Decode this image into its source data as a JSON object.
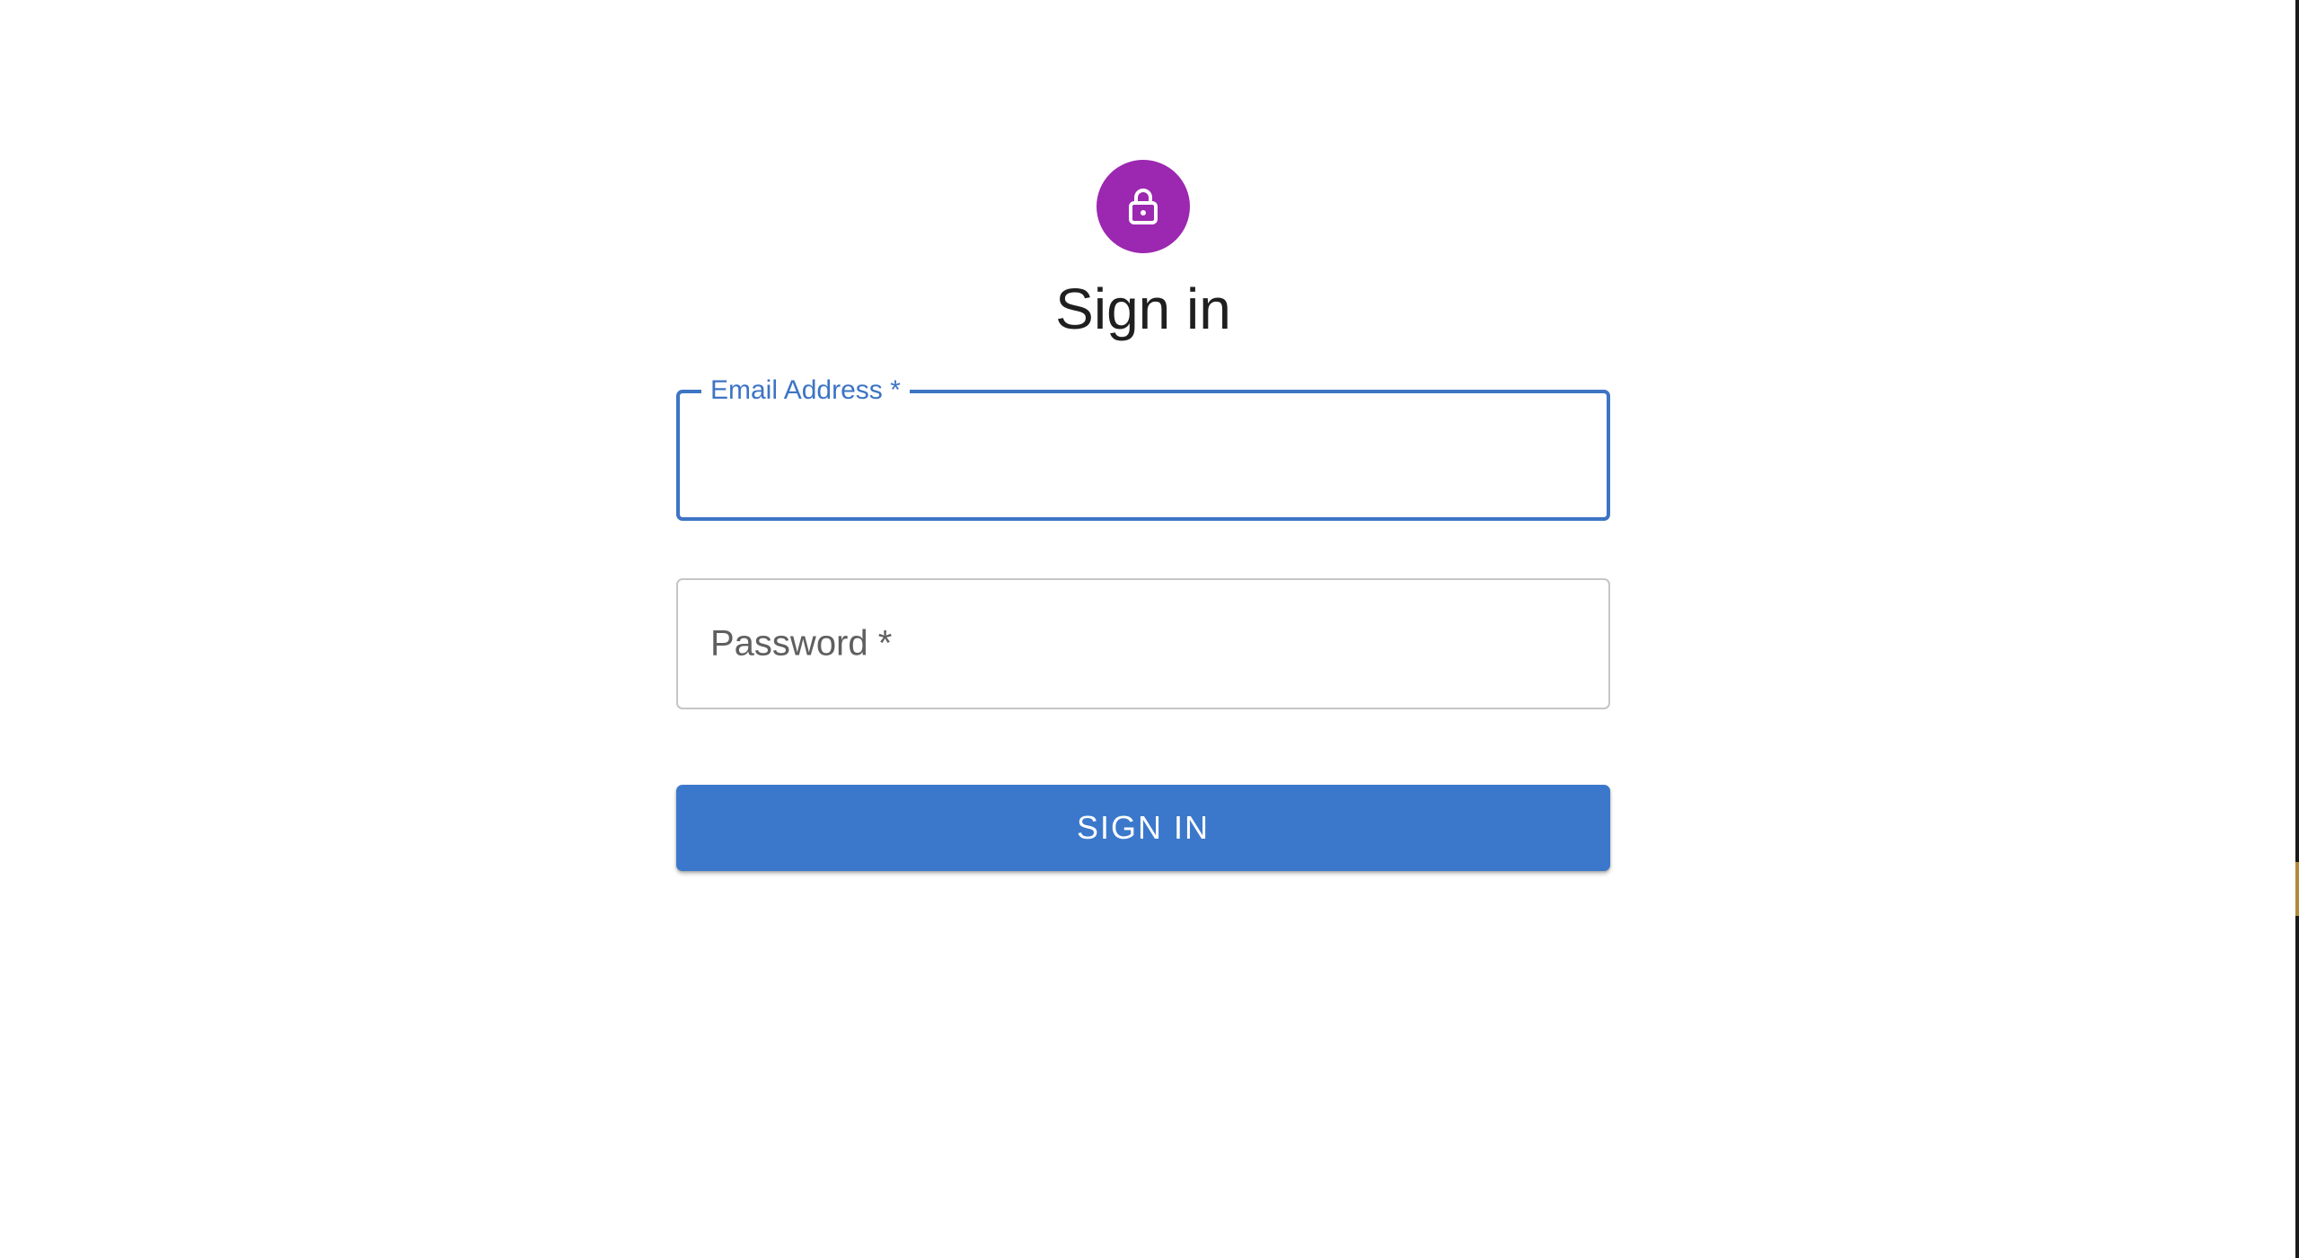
{
  "page": {
    "title": "Sign in"
  },
  "avatar": {
    "icon": "lock-icon",
    "color": "#9c27b0"
  },
  "form": {
    "email": {
      "label": "Email Address *",
      "value": "",
      "state": "focused"
    },
    "password": {
      "label": "Password *",
      "value": ""
    },
    "submit_label": "SIGN IN"
  },
  "colors": {
    "primary": "#3b78cc",
    "focus_border": "#3d74c4",
    "avatar": "#9c27b0",
    "text": "#1f1f1f",
    "muted_label": "#5f5f5f"
  }
}
